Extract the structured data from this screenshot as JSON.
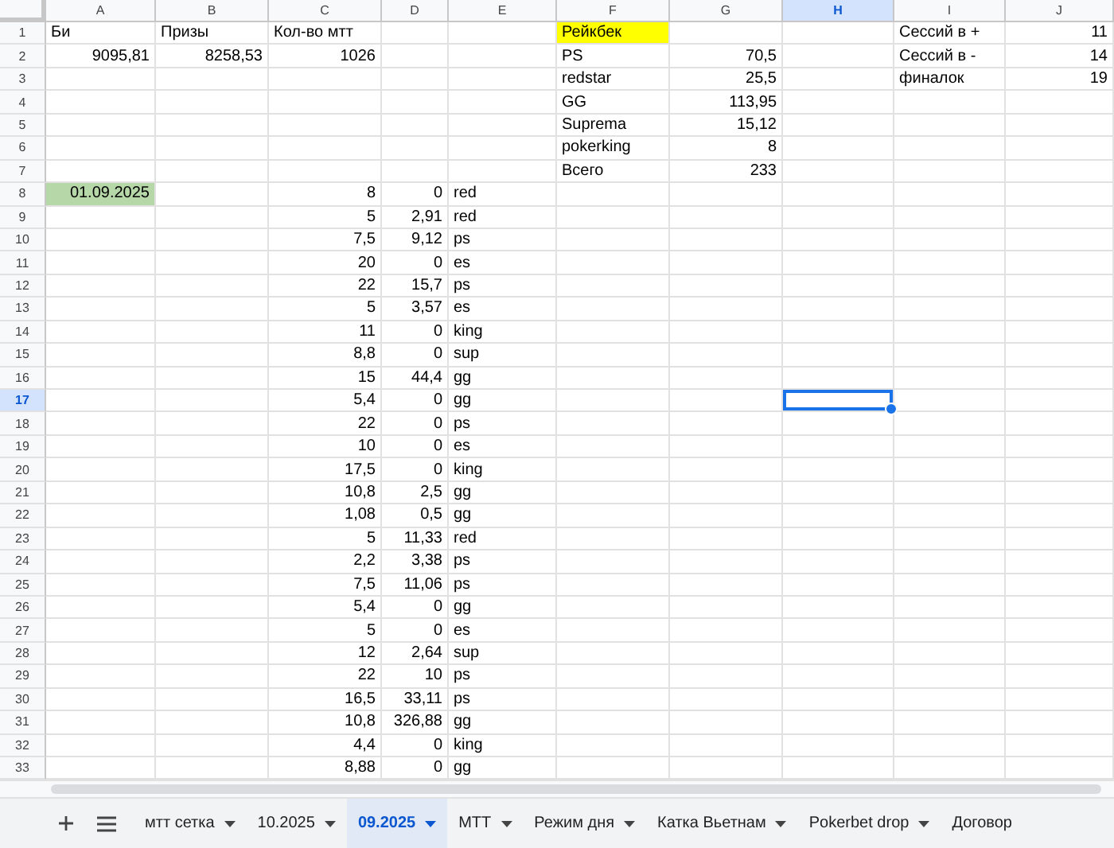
{
  "columns": [
    {
      "label": "A",
      "selected": false
    },
    {
      "label": "B",
      "selected": false
    },
    {
      "label": "C",
      "selected": false
    },
    {
      "label": "D",
      "selected": false
    },
    {
      "label": "E",
      "selected": false
    },
    {
      "label": "F",
      "selected": false
    },
    {
      "label": "G",
      "selected": false
    },
    {
      "label": "H",
      "selected": true
    },
    {
      "label": "I",
      "selected": false
    },
    {
      "label": "J",
      "selected": false
    }
  ],
  "rows": [
    {
      "number": "1",
      "selected": false,
      "cells": {
        "A": {
          "text": "Би",
          "kind": "text"
        },
        "B": {
          "text": "Призы",
          "kind": "text"
        },
        "C": {
          "text": "Кол-во мтт",
          "kind": "text"
        },
        "F": {
          "text": "Рейкбек",
          "kind": "text",
          "color": "#ffff00"
        },
        "I": {
          "text": "Сессий в +",
          "kind": "text"
        },
        "J": {
          "text": "11",
          "kind": "number"
        }
      }
    },
    {
      "number": "2",
      "selected": false,
      "cells": {
        "A": {
          "text": "9095,81",
          "kind": "number"
        },
        "B": {
          "text": "8258,53",
          "kind": "number"
        },
        "C": {
          "text": "1026",
          "kind": "number"
        },
        "F": {
          "text": "PS",
          "kind": "text"
        },
        "G": {
          "text": "70,5",
          "kind": "number"
        },
        "I": {
          "text": "Сессий в -",
          "kind": "text"
        },
        "J": {
          "text": "14",
          "kind": "number"
        }
      }
    },
    {
      "number": "3",
      "selected": false,
      "cells": {
        "F": {
          "text": "redstar",
          "kind": "text"
        },
        "G": {
          "text": "25,5",
          "kind": "number"
        },
        "I": {
          "text": "финалок",
          "kind": "text"
        },
        "J": {
          "text": "19",
          "kind": "number"
        }
      }
    },
    {
      "number": "4",
      "selected": false,
      "cells": {
        "F": {
          "text": "GG",
          "kind": "text"
        },
        "G": {
          "text": "113,95",
          "kind": "number"
        }
      }
    },
    {
      "number": "5",
      "selected": false,
      "cells": {
        "F": {
          "text": "Suprema",
          "kind": "text"
        },
        "G": {
          "text": "15,12",
          "kind": "number"
        }
      }
    },
    {
      "number": "6",
      "selected": false,
      "cells": {
        "F": {
          "text": "pokerking",
          "kind": "text"
        },
        "G": {
          "text": "8",
          "kind": "number"
        }
      }
    },
    {
      "number": "7",
      "selected": false,
      "cells": {
        "F": {
          "text": "Всего",
          "kind": "text"
        },
        "G": {
          "text": "233",
          "kind": "number"
        }
      }
    },
    {
      "number": "8",
      "selected": false,
      "cells": {
        "A": {
          "text": "01.09.2025",
          "kind": "number",
          "color": "#b6d7a8"
        },
        "C": {
          "text": "8",
          "kind": "number"
        },
        "D": {
          "text": "0",
          "kind": "number"
        },
        "E": {
          "text": "red",
          "kind": "text"
        }
      }
    },
    {
      "number": "9",
      "selected": false,
      "cells": {
        "C": {
          "text": "5",
          "kind": "number"
        },
        "D": {
          "text": "2,91",
          "kind": "number"
        },
        "E": {
          "text": "red",
          "kind": "text"
        }
      }
    },
    {
      "number": "10",
      "selected": false,
      "cells": {
        "C": {
          "text": "7,5",
          "kind": "number"
        },
        "D": {
          "text": "9,12",
          "kind": "number"
        },
        "E": {
          "text": "ps",
          "kind": "text"
        }
      }
    },
    {
      "number": "11",
      "selected": false,
      "cells": {
        "C": {
          "text": "20",
          "kind": "number"
        },
        "D": {
          "text": "0",
          "kind": "number"
        },
        "E": {
          "text": "es",
          "kind": "text"
        }
      }
    },
    {
      "number": "12",
      "selected": false,
      "cells": {
        "C": {
          "text": "22",
          "kind": "number"
        },
        "D": {
          "text": "15,7",
          "kind": "number"
        },
        "E": {
          "text": "ps",
          "kind": "text"
        }
      }
    },
    {
      "number": "13",
      "selected": false,
      "cells": {
        "C": {
          "text": "5",
          "kind": "number"
        },
        "D": {
          "text": "3,57",
          "kind": "number"
        },
        "E": {
          "text": "es",
          "kind": "text"
        }
      }
    },
    {
      "number": "14",
      "selected": false,
      "cells": {
        "C": {
          "text": "11",
          "kind": "number"
        },
        "D": {
          "text": "0",
          "kind": "number"
        },
        "E": {
          "text": "king",
          "kind": "text"
        }
      }
    },
    {
      "number": "15",
      "selected": false,
      "cells": {
        "C": {
          "text": "8,8",
          "kind": "number"
        },
        "D": {
          "text": "0",
          "kind": "number"
        },
        "E": {
          "text": "sup",
          "kind": "text"
        }
      }
    },
    {
      "number": "16",
      "selected": false,
      "cells": {
        "C": {
          "text": "15",
          "kind": "number"
        },
        "D": {
          "text": "44,4",
          "kind": "number"
        },
        "E": {
          "text": "gg",
          "kind": "text"
        }
      }
    },
    {
      "number": "17",
      "selected": true,
      "cells": {
        "C": {
          "text": "5,4",
          "kind": "number"
        },
        "D": {
          "text": "0",
          "kind": "number"
        },
        "E": {
          "text": "gg",
          "kind": "text"
        }
      }
    },
    {
      "number": "18",
      "selected": false,
      "cells": {
        "C": {
          "text": "22",
          "kind": "number"
        },
        "D": {
          "text": "0",
          "kind": "number"
        },
        "E": {
          "text": "ps",
          "kind": "text"
        }
      }
    },
    {
      "number": "19",
      "selected": false,
      "cells": {
        "C": {
          "text": "10",
          "kind": "number"
        },
        "D": {
          "text": "0",
          "kind": "number"
        },
        "E": {
          "text": "es",
          "kind": "text"
        }
      }
    },
    {
      "number": "20",
      "selected": false,
      "cells": {
        "C": {
          "text": "17,5",
          "kind": "number"
        },
        "D": {
          "text": "0",
          "kind": "number"
        },
        "E": {
          "text": "king",
          "kind": "text"
        }
      }
    },
    {
      "number": "21",
      "selected": false,
      "cells": {
        "C": {
          "text": "10,8",
          "kind": "number"
        },
        "D": {
          "text": "2,5",
          "kind": "number"
        },
        "E": {
          "text": "gg",
          "kind": "text"
        }
      }
    },
    {
      "number": "22",
      "selected": false,
      "cells": {
        "C": {
          "text": "1,08",
          "kind": "number"
        },
        "D": {
          "text": "0,5",
          "kind": "number"
        },
        "E": {
          "text": "gg",
          "kind": "text"
        }
      }
    },
    {
      "number": "23",
      "selected": false,
      "cells": {
        "C": {
          "text": "5",
          "kind": "number"
        },
        "D": {
          "text": "11,33",
          "kind": "number"
        },
        "E": {
          "text": "red",
          "kind": "text"
        }
      }
    },
    {
      "number": "24",
      "selected": false,
      "cells": {
        "C": {
          "text": "2,2",
          "kind": "number"
        },
        "D": {
          "text": "3,38",
          "kind": "number"
        },
        "E": {
          "text": "ps",
          "kind": "text"
        }
      }
    },
    {
      "number": "25",
      "selected": false,
      "cells": {
        "C": {
          "text": "7,5",
          "kind": "number"
        },
        "D": {
          "text": "11,06",
          "kind": "number"
        },
        "E": {
          "text": "ps",
          "kind": "text"
        }
      }
    },
    {
      "number": "26",
      "selected": false,
      "cells": {
        "C": {
          "text": "5,4",
          "kind": "number"
        },
        "D": {
          "text": "0",
          "kind": "number"
        },
        "E": {
          "text": "gg",
          "kind": "text"
        }
      }
    },
    {
      "number": "27",
      "selected": false,
      "cells": {
        "C": {
          "text": "5",
          "kind": "number"
        },
        "D": {
          "text": "0",
          "kind": "number"
        },
        "E": {
          "text": "es",
          "kind": "text"
        }
      }
    },
    {
      "number": "28",
      "selected": false,
      "cells": {
        "C": {
          "text": "12",
          "kind": "number"
        },
        "D": {
          "text": "2,64",
          "kind": "number"
        },
        "E": {
          "text": "sup",
          "kind": "text"
        }
      }
    },
    {
      "number": "29",
      "selected": false,
      "cells": {
        "C": {
          "text": "22",
          "kind": "number"
        },
        "D": {
          "text": "10",
          "kind": "number"
        },
        "E": {
          "text": "ps",
          "kind": "text"
        }
      }
    },
    {
      "number": "30",
      "selected": false,
      "cells": {
        "C": {
          "text": "16,5",
          "kind": "number"
        },
        "D": {
          "text": "33,11",
          "kind": "number"
        },
        "E": {
          "text": "ps",
          "kind": "text"
        }
      }
    },
    {
      "number": "31",
      "selected": false,
      "cells": {
        "C": {
          "text": "10,8",
          "kind": "number"
        },
        "D": {
          "text": "326,88",
          "kind": "number"
        },
        "E": {
          "text": "gg",
          "kind": "text"
        }
      }
    },
    {
      "number": "32",
      "selected": false,
      "cells": {
        "C": {
          "text": "4,4",
          "kind": "number"
        },
        "D": {
          "text": "0",
          "kind": "number"
        },
        "E": {
          "text": "king",
          "kind": "text"
        }
      }
    },
    {
      "number": "33",
      "selected": false,
      "cells": {
        "C": {
          "text": "8,88",
          "kind": "number"
        },
        "D": {
          "text": "0",
          "kind": "number"
        },
        "E": {
          "text": "gg",
          "kind": "text"
        }
      }
    }
  ],
  "sheet_tabs": [
    {
      "label": "мтт сетка",
      "selected": false,
      "menu": true
    },
    {
      "label": "10.2025",
      "selected": false,
      "menu": true
    },
    {
      "label": "09.2025",
      "selected": true,
      "menu": true
    },
    {
      "label": "МТТ",
      "selected": false,
      "menu": true
    },
    {
      "label": "Режим дня",
      "selected": false,
      "menu": true
    },
    {
      "label": "Катка Вьетнам",
      "selected": false,
      "menu": true
    },
    {
      "label": "Pokerbet drop",
      "selected": false,
      "menu": true
    },
    {
      "label": "Договор",
      "selected": false,
      "menu": false
    }
  ]
}
